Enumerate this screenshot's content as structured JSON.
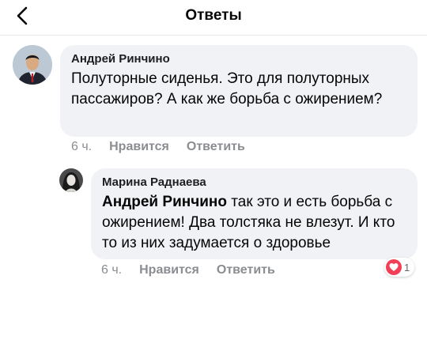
{
  "header": {
    "title": "Ответы",
    "back_icon": "chevron-left-icon"
  },
  "comments": [
    {
      "author": "Андрей Ринчино",
      "text": "Полуторные сиденья. Это для полуторных пассажиров? А как же борьба с ожирением?",
      "time": "6 ч.",
      "like_label": "Нравится",
      "reply_label": "Ответить"
    },
    {
      "author": "Марина Раднаева",
      "mention": "Андрей Ринчино",
      "text": "так это и есть борьба с ожирением! Два толстяка не влезут. И кто то из них задумается о здоровье",
      "time": "6 ч.",
      "like_label": "Нравится",
      "reply_label": "Ответить",
      "reaction": {
        "icon": "love-reaction-icon",
        "count": "1",
        "color": "#f33e58"
      }
    }
  ]
}
